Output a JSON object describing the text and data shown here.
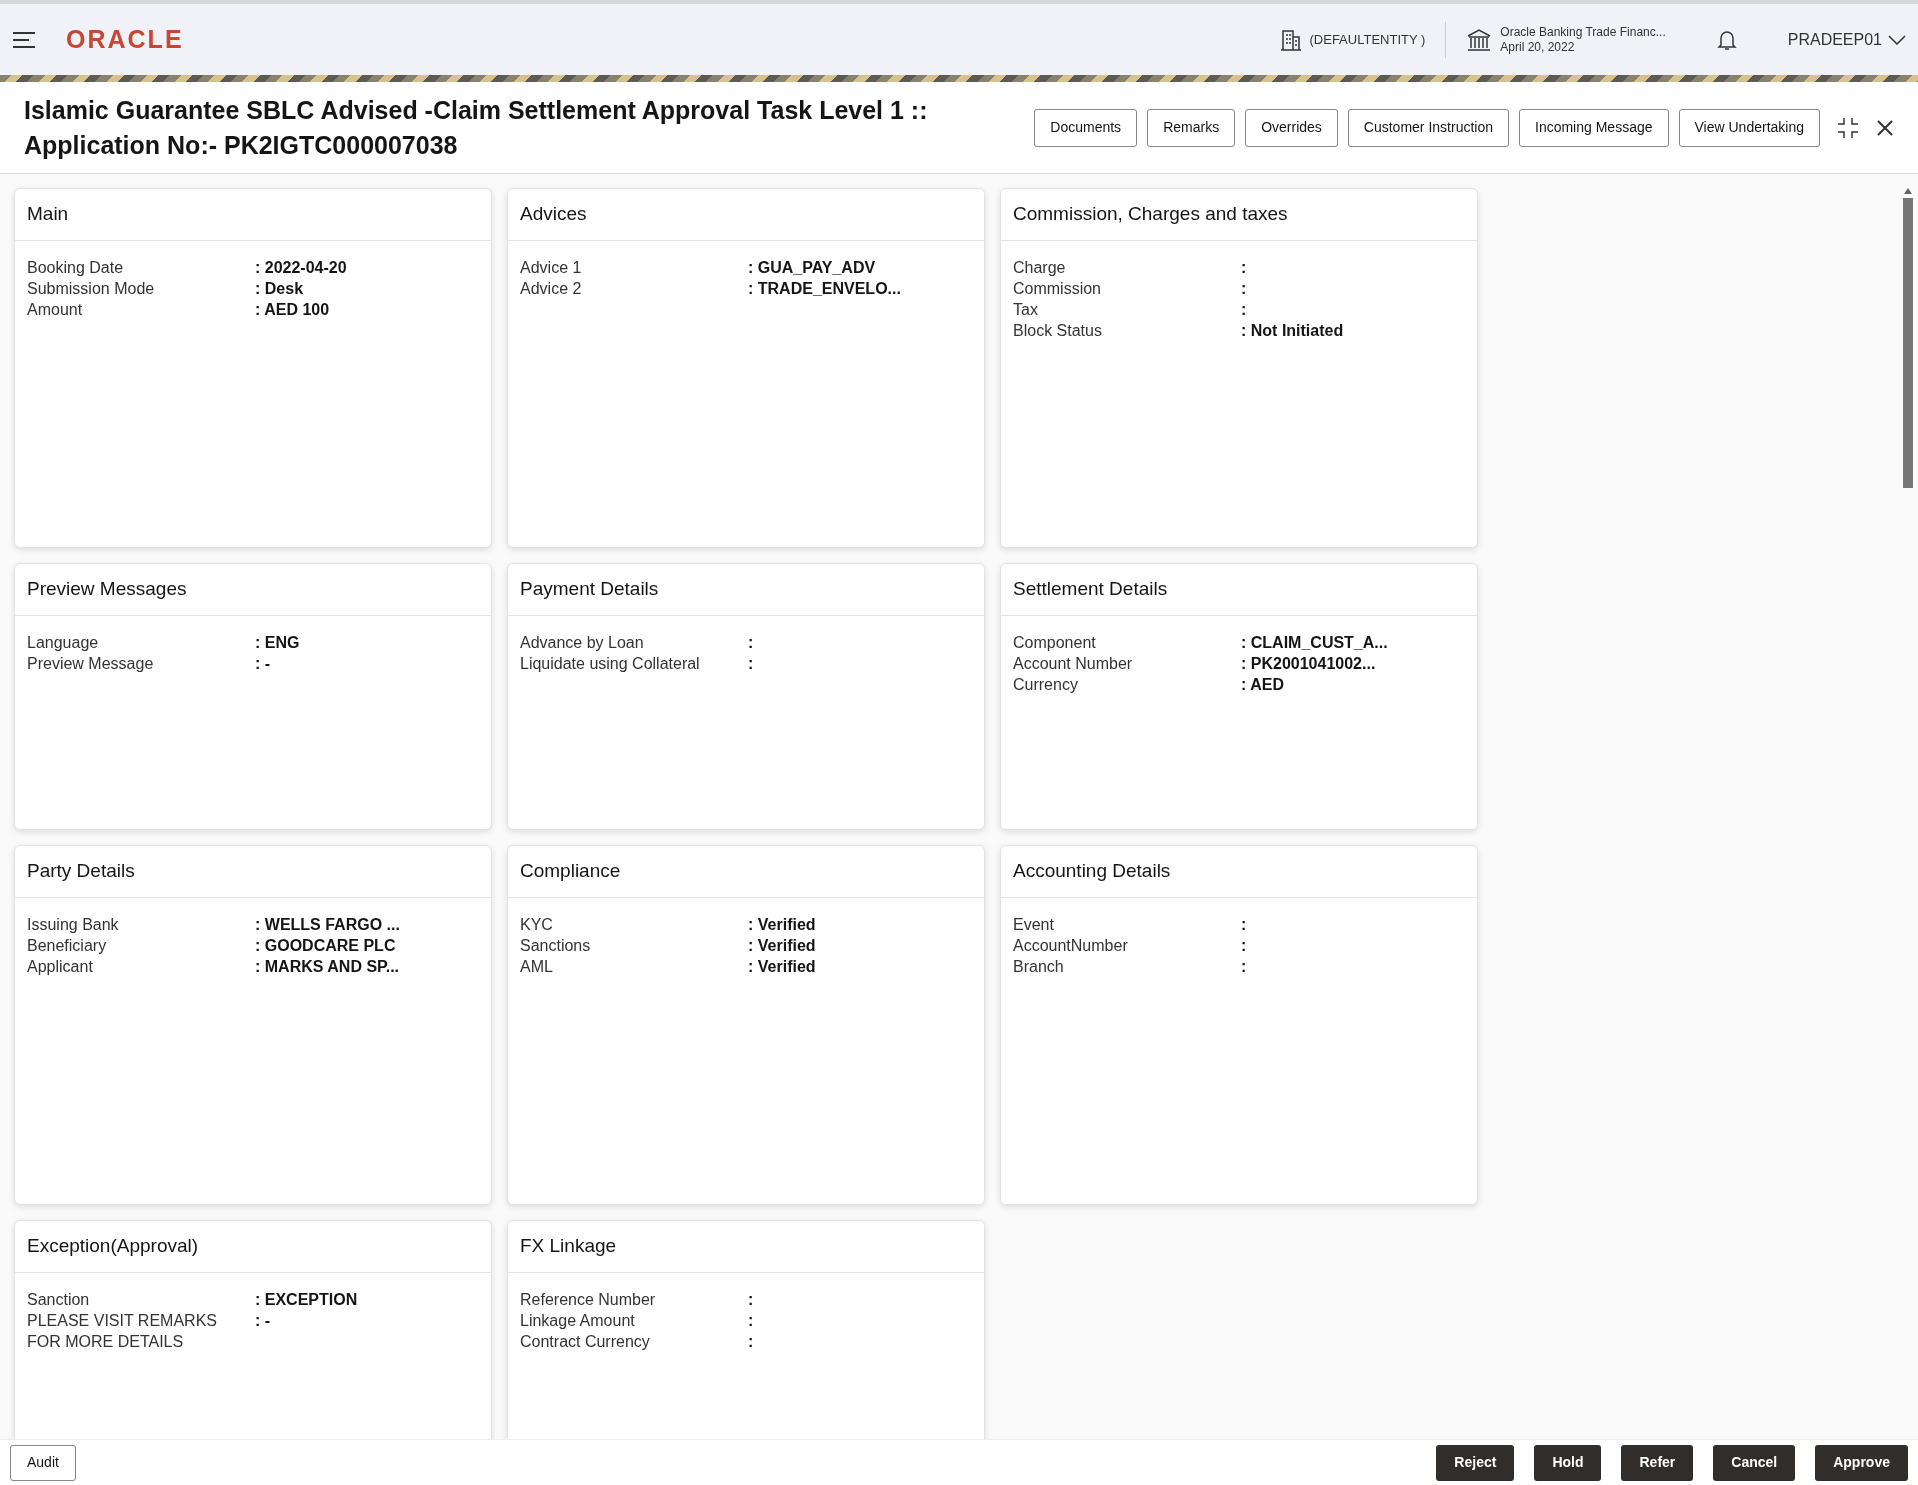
{
  "header": {
    "brand": "ORACLE",
    "entity": "(DEFAULTENTITY )",
    "branch": "Oracle Banking Trade Financ...",
    "date": "April 20, 2022",
    "user": "PRADEEP01"
  },
  "title": {
    "line1": "Islamic Guarantee SBLC Advised -Claim Settlement Approval Task Level 1 ::",
    "line2": "Application No:- PK2IGTC000007038"
  },
  "toolbar": [
    "Documents",
    "Remarks",
    "Overrides",
    "Customer Instruction",
    "Incoming Message",
    "View Undertaking"
  ],
  "cards": [
    {
      "title": "Main",
      "fields": [
        {
          "label": "Booking Date",
          "value": ": 2022-04-20"
        },
        {
          "label": "Submission Mode",
          "value": ": Desk"
        },
        {
          "label": "Amount",
          "value": ": AED 100"
        }
      ]
    },
    {
      "title": "Advices",
      "fields": [
        {
          "label": "Advice 1",
          "value": ": GUA_PAY_ADV"
        },
        {
          "label": "Advice 2",
          "value": ": TRADE_ENVELO..."
        }
      ]
    },
    {
      "title": "Commission, Charges and taxes",
      "fields": [
        {
          "label": "Charge",
          "value": ":"
        },
        {
          "label": "Commission",
          "value": ":"
        },
        {
          "label": "Tax",
          "value": ":"
        },
        {
          "label": "Block Status",
          "value": ": Not Initiated"
        }
      ]
    },
    {
      "title": "Preview Messages",
      "fields": [
        {
          "label": "Language",
          "value": ": ENG"
        },
        {
          "label": "Preview Message",
          "value": ": -"
        }
      ]
    },
    {
      "title": "Payment Details",
      "fields": [
        {
          "label": "Advance by Loan",
          "value": ":"
        },
        {
          "label": "Liquidate using Collateral",
          "value": ":"
        }
      ]
    },
    {
      "title": "Settlement Details",
      "fields": [
        {
          "label": "Component",
          "value": ": CLAIM_CUST_A..."
        },
        {
          "label": "Account Number",
          "value": ": PK2001041002..."
        },
        {
          "label": "Currency",
          "value": ": AED"
        }
      ]
    },
    {
      "title": "Party Details",
      "fields": [
        {
          "label": "Issuing Bank",
          "value": ": WELLS FARGO ..."
        },
        {
          "label": "Beneficiary",
          "value": ": GOODCARE PLC"
        },
        {
          "label": "Applicant",
          "value": ": MARKS AND SP..."
        }
      ]
    },
    {
      "title": "Compliance",
      "fields": [
        {
          "label": "KYC",
          "value": ": Verified"
        },
        {
          "label": "Sanctions",
          "value": ": Verified"
        },
        {
          "label": "AML",
          "value": ": Verified"
        }
      ]
    },
    {
      "title": "Accounting Details",
      "fields": [
        {
          "label": "Event",
          "value": ":"
        },
        {
          "label": "AccountNumber",
          "value": ":"
        },
        {
          "label": "Branch",
          "value": ":"
        }
      ]
    },
    {
      "title": "Exception(Approval)",
      "fields": [
        {
          "label": "Sanction",
          "value": ": EXCEPTION"
        },
        {
          "label": "PLEASE VISIT REMARKS FOR MORE DETAILS",
          "value": ": -"
        }
      ]
    },
    {
      "title": "FX Linkage",
      "fields": [
        {
          "label": "Reference Number",
          "value": ":"
        },
        {
          "label": "Linkage Amount",
          "value": ":"
        },
        {
          "label": "Contract Currency",
          "value": ":"
        }
      ]
    }
  ],
  "footer": {
    "audit": "Audit",
    "actions": [
      "Reject",
      "Hold",
      "Refer",
      "Cancel",
      "Approve"
    ]
  }
}
